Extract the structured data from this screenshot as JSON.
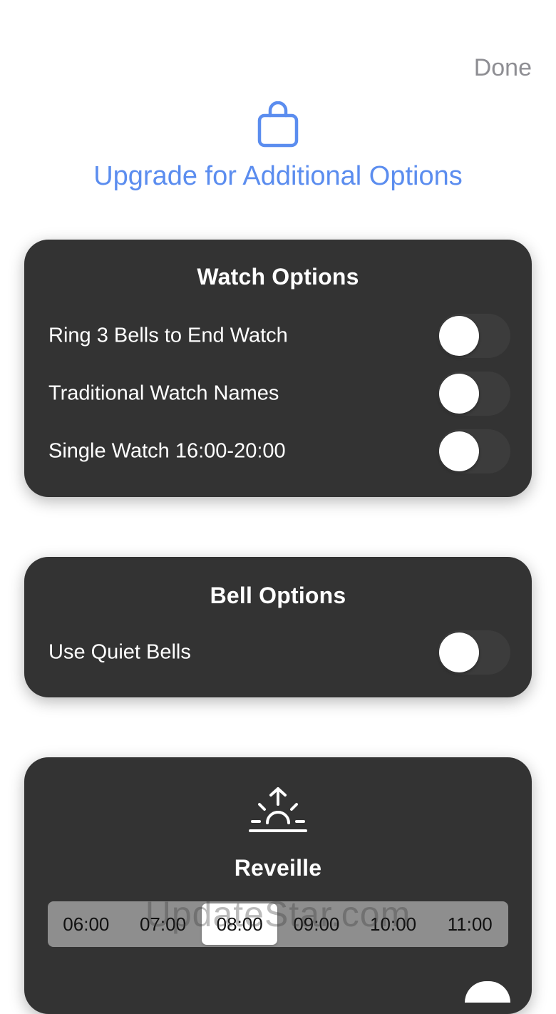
{
  "header": {
    "done_label": "Done",
    "icon": "shopping-bag-icon",
    "upgrade_title": "Upgrade for Additional Options"
  },
  "watch_options": {
    "title": "Watch Options",
    "rows": [
      {
        "label": "Ring 3 Bells to End Watch",
        "on": false
      },
      {
        "label": "Traditional Watch Names",
        "on": false
      },
      {
        "label": "Single Watch 16:00-20:00",
        "on": false
      }
    ]
  },
  "bell_options": {
    "title": "Bell Options",
    "rows": [
      {
        "label": "Use Quiet Bells",
        "on": false
      }
    ]
  },
  "reveille": {
    "icon": "sunrise-icon",
    "title": "Reveille",
    "times": [
      "06:00",
      "07:00",
      "08:00",
      "09:00",
      "10:00",
      "11:00"
    ],
    "selected": "08:00"
  },
  "watermark": "UpdateStar.com",
  "colors": {
    "accent": "#5b8def",
    "card": "#333333",
    "done": "#8e8e93"
  }
}
